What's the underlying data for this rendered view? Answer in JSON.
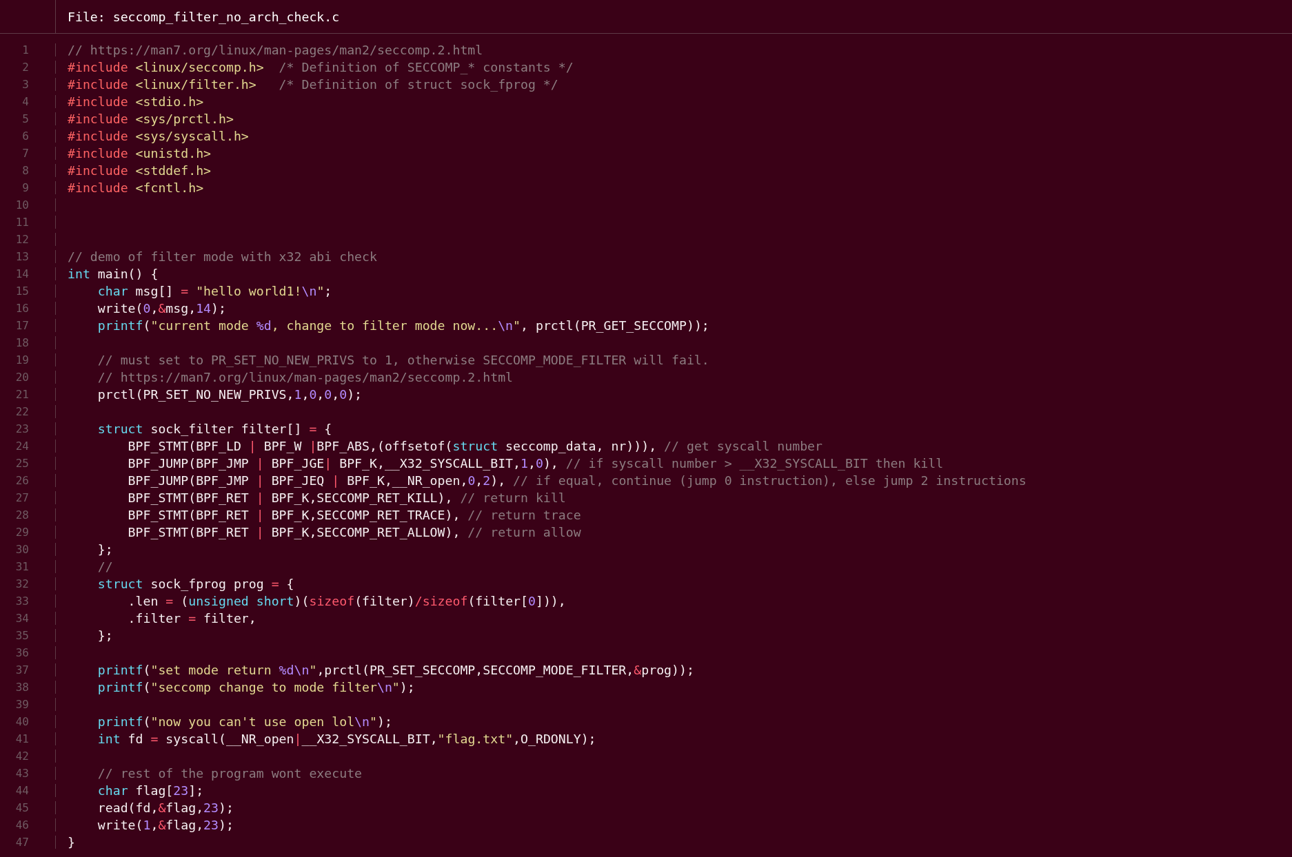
{
  "file_header": {
    "title": "File: seccomp_filter_no_arch_check.c"
  },
  "lines": [
    {
      "number": "1",
      "tokens": [
        {
          "kind": "comment",
          "text": "// https://man7.org/linux/man-pages/man2/seccomp.2.html"
        }
      ]
    },
    {
      "number": "2",
      "tokens": [
        {
          "kind": "directive",
          "text": "#include"
        },
        {
          "kind": "string",
          "text": " <linux/seccomp.h>"
        },
        {
          "kind": "comment",
          "text": "  /* Definition of SECCOMP_* constants */"
        }
      ]
    },
    {
      "number": "3",
      "tokens": [
        {
          "kind": "directive",
          "text": "#include"
        },
        {
          "kind": "string",
          "text": " <linux/filter.h>"
        },
        {
          "kind": "comment",
          "text": "   /* Definition of struct sock_fprog */"
        }
      ]
    },
    {
      "number": "4",
      "tokens": [
        {
          "kind": "directive",
          "text": "#include"
        },
        {
          "kind": "string",
          "text": " <stdio.h>"
        }
      ]
    },
    {
      "number": "5",
      "tokens": [
        {
          "kind": "directive",
          "text": "#include"
        },
        {
          "kind": "string",
          "text": " <sys/prctl.h>"
        }
      ]
    },
    {
      "number": "6",
      "tokens": [
        {
          "kind": "directive",
          "text": "#include"
        },
        {
          "kind": "string",
          "text": " <sys/syscall.h>"
        }
      ]
    },
    {
      "number": "7",
      "tokens": [
        {
          "kind": "directive",
          "text": "#include"
        },
        {
          "kind": "string",
          "text": " <unistd.h>"
        }
      ]
    },
    {
      "number": "8",
      "tokens": [
        {
          "kind": "directive",
          "text": "#include"
        },
        {
          "kind": "string",
          "text": " <stddef.h>"
        }
      ]
    },
    {
      "number": "9",
      "tokens": [
        {
          "kind": "directive",
          "text": "#include"
        },
        {
          "kind": "string",
          "text": " <fcntl.h>"
        }
      ]
    },
    {
      "number": "10"
    },
    {
      "number": "11"
    },
    {
      "number": "12"
    },
    {
      "number": "13",
      "tokens": [
        {
          "kind": "comment",
          "text": "// demo of filter mode with x32 abi check"
        }
      ]
    },
    {
      "number": "14",
      "tokens": [
        {
          "kind": "keyword",
          "text": "int"
        },
        {
          "kind": "plain",
          "text": " main() {"
        }
      ]
    },
    {
      "number": "15",
      "tokens": [
        {
          "kind": "keyword",
          "text": "    char"
        },
        {
          "kind": "plain",
          "text": " msg[] "
        },
        {
          "kind": "operator",
          "text": "="
        },
        {
          "kind": "string",
          "text": " \"hello world1!"
        },
        {
          "kind": "escape",
          "text": "\\n"
        },
        {
          "kind": "string",
          "text": "\""
        },
        {
          "kind": "plain",
          "text": ";"
        }
      ]
    },
    {
      "number": "16",
      "tokens": [
        {
          "kind": "plain",
          "text": "    write("
        },
        {
          "kind": "number",
          "text": "0"
        },
        {
          "kind": "plain",
          "text": ","
        },
        {
          "kind": "operator",
          "text": "&"
        },
        {
          "kind": "plain",
          "text": "msg,"
        },
        {
          "kind": "number",
          "text": "14"
        },
        {
          "kind": "plain",
          "text": ");"
        }
      ]
    },
    {
      "number": "17",
      "tokens": [
        {
          "kind": "keyword",
          "text": "    printf"
        },
        {
          "kind": "plain",
          "text": "("
        },
        {
          "kind": "string",
          "text": "\"current mode "
        },
        {
          "kind": "escape",
          "text": "%d"
        },
        {
          "kind": "string",
          "text": ", change to filter mode now..."
        },
        {
          "kind": "escape",
          "text": "\\n"
        },
        {
          "kind": "string",
          "text": "\""
        },
        {
          "kind": "plain",
          "text": ", prctl(PR_GET_SECCOMP));"
        }
      ]
    },
    {
      "number": "18"
    },
    {
      "number": "19",
      "tokens": [
        {
          "kind": "comment",
          "text": "    // must set to PR_SET_NO_NEW_PRIVS to 1, otherwise SECCOMP_MODE_FILTER will fail."
        }
      ]
    },
    {
      "number": "20",
      "tokens": [
        {
          "kind": "comment",
          "text": "    // https://man7.org/linux/man-pages/man2/seccomp.2.html"
        }
      ]
    },
    {
      "number": "21",
      "tokens": [
        {
          "kind": "plain",
          "text": "    prctl(PR_SET_NO_NEW_PRIVS,"
        },
        {
          "kind": "number",
          "text": "1"
        },
        {
          "kind": "plain",
          "text": ","
        },
        {
          "kind": "number",
          "text": "0"
        },
        {
          "kind": "plain",
          "text": ","
        },
        {
          "kind": "number",
          "text": "0"
        },
        {
          "kind": "plain",
          "text": ","
        },
        {
          "kind": "number",
          "text": "0"
        },
        {
          "kind": "plain",
          "text": ");"
        }
      ]
    },
    {
      "number": "22"
    },
    {
      "number": "23",
      "tokens": [
        {
          "kind": "keyword",
          "text": "    struct"
        },
        {
          "kind": "plain",
          "text": " sock_filter filter[] "
        },
        {
          "kind": "operator",
          "text": "="
        },
        {
          "kind": "plain",
          "text": " {"
        }
      ]
    },
    {
      "number": "24",
      "tokens": [
        {
          "kind": "plain",
          "text": "        BPF_STMT(BPF_LD "
        },
        {
          "kind": "operator",
          "text": "|"
        },
        {
          "kind": "plain",
          "text": " BPF_W "
        },
        {
          "kind": "operator",
          "text": "|"
        },
        {
          "kind": "plain",
          "text": "BPF_ABS,(offsetof("
        },
        {
          "kind": "keyword",
          "text": "struct"
        },
        {
          "kind": "plain",
          "text": " seccomp_data, nr))), "
        },
        {
          "kind": "comment",
          "text": "// get syscall number"
        }
      ]
    },
    {
      "number": "25",
      "tokens": [
        {
          "kind": "plain",
          "text": "        BPF_JUMP(BPF_JMP "
        },
        {
          "kind": "operator",
          "text": "|"
        },
        {
          "kind": "plain",
          "text": " BPF_JGE"
        },
        {
          "kind": "operator",
          "text": "|"
        },
        {
          "kind": "plain",
          "text": " BPF_K,__X32_SYSCALL_BIT,"
        },
        {
          "kind": "number",
          "text": "1"
        },
        {
          "kind": "plain",
          "text": ","
        },
        {
          "kind": "number",
          "text": "0"
        },
        {
          "kind": "plain",
          "text": "), "
        },
        {
          "kind": "comment",
          "text": "// if syscall number > __X32_SYSCALL_BIT then kill"
        }
      ]
    },
    {
      "number": "26",
      "tokens": [
        {
          "kind": "plain",
          "text": "        BPF_JUMP(BPF_JMP "
        },
        {
          "kind": "operator",
          "text": "|"
        },
        {
          "kind": "plain",
          "text": " BPF_JEQ "
        },
        {
          "kind": "operator",
          "text": "|"
        },
        {
          "kind": "plain",
          "text": " BPF_K,__NR_open,"
        },
        {
          "kind": "number",
          "text": "0"
        },
        {
          "kind": "plain",
          "text": ","
        },
        {
          "kind": "number",
          "text": "2"
        },
        {
          "kind": "plain",
          "text": "), "
        },
        {
          "kind": "comment",
          "text": "// if equal, continue (jump 0 instruction), else jump 2 instructions"
        }
      ]
    },
    {
      "number": "27",
      "tokens": [
        {
          "kind": "plain",
          "text": "        BPF_STMT(BPF_RET "
        },
        {
          "kind": "operator",
          "text": "|"
        },
        {
          "kind": "plain",
          "text": " BPF_K,SECCOMP_RET_KILL), "
        },
        {
          "kind": "comment",
          "text": "// return kill"
        }
      ]
    },
    {
      "number": "28",
      "tokens": [
        {
          "kind": "plain",
          "text": "        BPF_STMT(BPF_RET "
        },
        {
          "kind": "operator",
          "text": "|"
        },
        {
          "kind": "plain",
          "text": " BPF_K,SECCOMP_RET_TRACE), "
        },
        {
          "kind": "comment",
          "text": "// return trace"
        }
      ]
    },
    {
      "number": "29",
      "tokens": [
        {
          "kind": "plain",
          "text": "        BPF_STMT(BPF_RET "
        },
        {
          "kind": "operator",
          "text": "|"
        },
        {
          "kind": "plain",
          "text": " BPF_K,SECCOMP_RET_ALLOW), "
        },
        {
          "kind": "comment",
          "text": "// return allow"
        }
      ]
    },
    {
      "number": "30",
      "tokens": [
        {
          "kind": "plain",
          "text": "    };"
        }
      ]
    },
    {
      "number": "31",
      "tokens": [
        {
          "kind": "comment",
          "text": "    //"
        }
      ]
    },
    {
      "number": "32",
      "tokens": [
        {
          "kind": "keyword",
          "text": "    struct"
        },
        {
          "kind": "plain",
          "text": " sock_fprog prog "
        },
        {
          "kind": "operator",
          "text": "="
        },
        {
          "kind": "plain",
          "text": " {"
        }
      ]
    },
    {
      "number": "33",
      "tokens": [
        {
          "kind": "plain",
          "text": "        .len "
        },
        {
          "kind": "operator",
          "text": "="
        },
        {
          "kind": "plain",
          "text": " ("
        },
        {
          "kind": "keyword",
          "text": "unsigned short"
        },
        {
          "kind": "plain",
          "text": ")("
        },
        {
          "kind": "operator",
          "text": "sizeof"
        },
        {
          "kind": "plain",
          "text": "(filter)"
        },
        {
          "kind": "operator",
          "text": "/sizeof"
        },
        {
          "kind": "plain",
          "text": "(filter["
        },
        {
          "kind": "number",
          "text": "0"
        },
        {
          "kind": "plain",
          "text": "])),"
        }
      ]
    },
    {
      "number": "34",
      "tokens": [
        {
          "kind": "plain",
          "text": "        .filter "
        },
        {
          "kind": "operator",
          "text": "="
        },
        {
          "kind": "plain",
          "text": " filter,"
        }
      ]
    },
    {
      "number": "35",
      "tokens": [
        {
          "kind": "plain",
          "text": "    };"
        }
      ]
    },
    {
      "number": "36"
    },
    {
      "number": "37",
      "tokens": [
        {
          "kind": "keyword",
          "text": "    printf"
        },
        {
          "kind": "plain",
          "text": "("
        },
        {
          "kind": "string",
          "text": "\"set mode return "
        },
        {
          "kind": "escape",
          "text": "%d\\n"
        },
        {
          "kind": "string",
          "text": "\""
        },
        {
          "kind": "plain",
          "text": ",prctl(PR_SET_SECCOMP,SECCOMP_MODE_FILTER,"
        },
        {
          "kind": "operator",
          "text": "&"
        },
        {
          "kind": "plain",
          "text": "prog));"
        }
      ]
    },
    {
      "number": "38",
      "tokens": [
        {
          "kind": "keyword",
          "text": "    printf"
        },
        {
          "kind": "plain",
          "text": "("
        },
        {
          "kind": "string",
          "text": "\"seccomp change to mode filter"
        },
        {
          "kind": "escape",
          "text": "\\n"
        },
        {
          "kind": "string",
          "text": "\""
        },
        {
          "kind": "plain",
          "text": ");"
        }
      ]
    },
    {
      "number": "39"
    },
    {
      "number": "40",
      "tokens": [
        {
          "kind": "keyword",
          "text": "    printf"
        },
        {
          "kind": "plain",
          "text": "("
        },
        {
          "kind": "string",
          "text": "\"now you can't use open lol"
        },
        {
          "kind": "escape",
          "text": "\\n"
        },
        {
          "kind": "string",
          "text": "\""
        },
        {
          "kind": "plain",
          "text": ");"
        }
      ]
    },
    {
      "number": "41",
      "tokens": [
        {
          "kind": "keyword",
          "text": "    int"
        },
        {
          "kind": "plain",
          "text": " fd "
        },
        {
          "kind": "operator",
          "text": "="
        },
        {
          "kind": "plain",
          "text": " syscall(__NR_open"
        },
        {
          "kind": "operator",
          "text": "|"
        },
        {
          "kind": "plain",
          "text": "__X32_SYSCALL_BIT,"
        },
        {
          "kind": "string",
          "text": "\"flag.txt\""
        },
        {
          "kind": "plain",
          "text": ",O_RDONLY);"
        }
      ]
    },
    {
      "number": "42"
    },
    {
      "number": "43",
      "tokens": [
        {
          "kind": "comment",
          "text": "    // rest of the program wont execute"
        }
      ]
    },
    {
      "number": "44",
      "tokens": [
        {
          "kind": "keyword",
          "text": "    char"
        },
        {
          "kind": "plain",
          "text": " flag["
        },
        {
          "kind": "number",
          "text": "23"
        },
        {
          "kind": "plain",
          "text": "];"
        }
      ]
    },
    {
      "number": "45",
      "tokens": [
        {
          "kind": "plain",
          "text": "    read(fd,"
        },
        {
          "kind": "operator",
          "text": "&"
        },
        {
          "kind": "plain",
          "text": "flag,"
        },
        {
          "kind": "number",
          "text": "23"
        },
        {
          "kind": "plain",
          "text": ");"
        }
      ]
    },
    {
      "number": "46",
      "tokens": [
        {
          "kind": "plain",
          "text": "    write("
        },
        {
          "kind": "number",
          "text": "1"
        },
        {
          "kind": "plain",
          "text": ","
        },
        {
          "kind": "operator",
          "text": "&"
        },
        {
          "kind": "plain",
          "text": "flag,"
        },
        {
          "kind": "number",
          "text": "23"
        },
        {
          "kind": "plain",
          "text": ");"
        }
      ]
    },
    {
      "number": "47",
      "tokens": [
        {
          "kind": "plain",
          "text": "}"
        }
      ]
    }
  ]
}
